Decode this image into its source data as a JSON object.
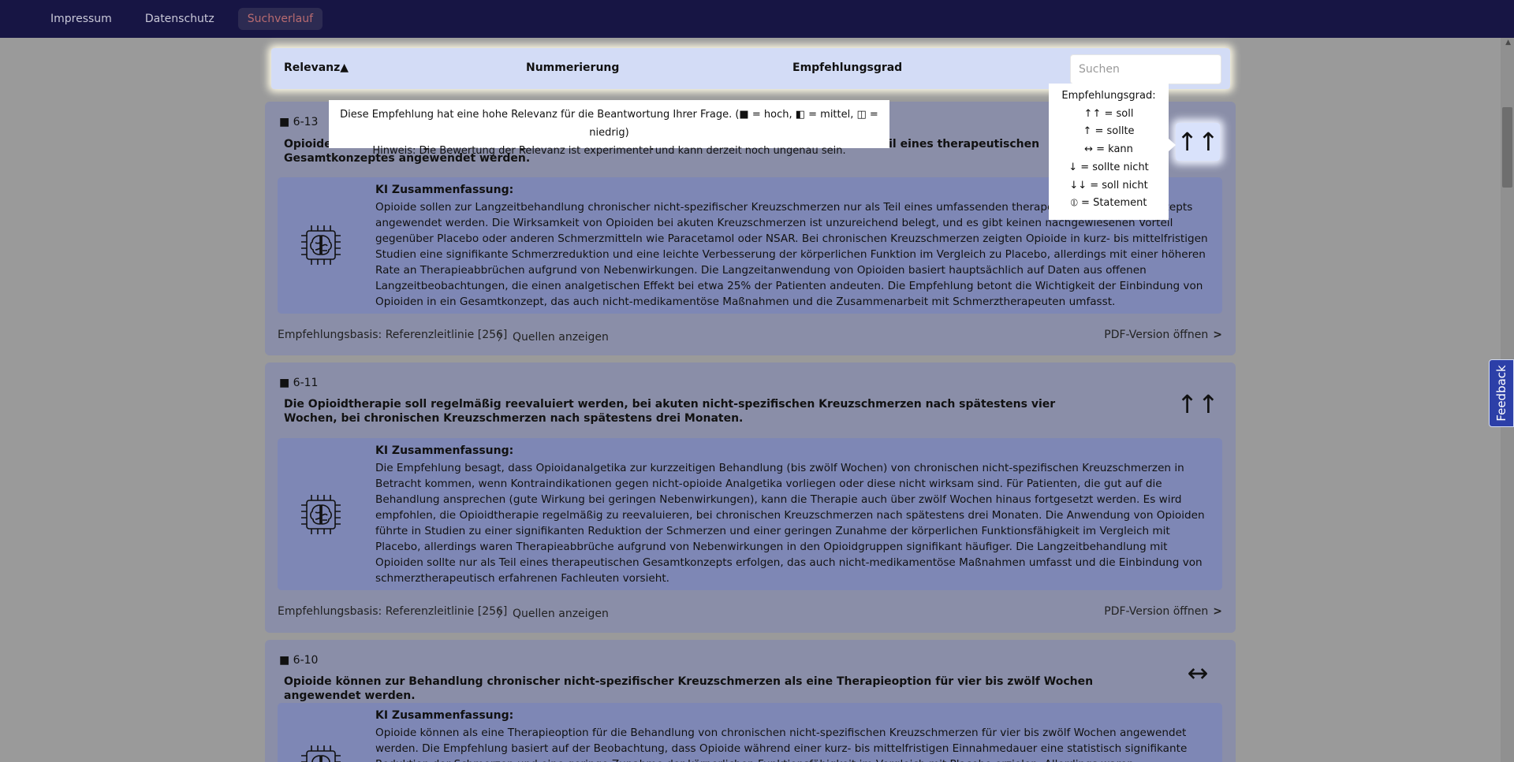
{
  "nav": {
    "items": [
      "Impressum",
      "Datenschutz",
      "Suchverlauf"
    ]
  },
  "sortbar": {
    "relevanz": "Relevanz▲",
    "nummerierung": "Nummerierung",
    "empfehlungsgrad": "Empfehlungsgrad",
    "search_placeholder": "Suchen"
  },
  "tooltip_relevance": {
    "line1": "Diese Empfehlung hat eine hohe Relevanz für die Beantwortung Ihrer Frage. (■ = hoch, ◧ = mittel, ◫ = niedrig)",
    "line2": "Hinweis: Die Bewertung der Relevanz ist experimentel und kann derzeit noch ungenau sein."
  },
  "tooltip_grade": {
    "title": "Empfehlungsgrad:",
    "items": [
      "↑↑ = soll",
      "↑ = sollte",
      "↔ = kann",
      "↓ = sollte nicht",
      "↓↓ = soll nicht",
      "⦶ = Statement"
    ]
  },
  "cards": [
    {
      "num": "■ 6-13",
      "title": "Opioide sollen zur Langzeitbehandlung chronischer nicht-spezifischer Kreuzschmerzen nur als Teil eines therapeutischen Gesamtkonzeptes angewendet werden.",
      "grade": "↑↑",
      "summary_head": "KI Zusammenfassung:",
      "summary": "Opioide sollen zur Langzeitbehandlung chronischer nicht-spezifischer Kreuzschmerzen nur als Teil eines umfassenden therapeutischen Gesamtkonzepts angewendet werden. Die Wirksamkeit von Opioiden bei akuten Kreuzschmerzen ist unzureichend belegt, und es gibt keinen nachgewiesenen Vorteil gegenüber Placebo oder anderen Schmerzmitteln wie Paracetamol oder NSAR. Bei chronischen Kreuzschmerzen zeigten Opioide in kurz- bis mittelfristigen Studien eine signifikante Schmerzreduktion und eine leichte Verbesserung der körperlichen Funktion im Vergleich zu Placebo, allerdings mit einer höheren Rate an Therapieabbrüchen aufgrund von Nebenwirkungen. Die Langzeitanwendung von Opioiden basiert hauptsächlich auf Daten aus offenen Langzeitbeobachtungen, die einen analgetischen Effekt bei etwa 25% der Patienten andeuten. Die Empfehlung betont die Wichtigkeit der Einbindung von Opioiden in ein Gesamtkonzept, das auch nicht-medikamentöse Maßnahmen und die Zusammenarbeit mit Schmerztherapeuten umfasst.",
      "basis": "Empfehlungsbasis: Referenzleitlinie [256]",
      "sources": "Quellen anzeigen",
      "pdf": "PDF-Version öffnen"
    },
    {
      "num": "■ 6-11",
      "title": "Die Opioidtherapie soll regelmäßig reevaluiert werden, bei akuten nicht-spezifischen Kreuzschmerzen nach spätestens vier Wochen, bei chronischen Kreuzschmerzen nach spätestens drei Monaten.",
      "grade": "↑↑",
      "summary_head": "KI Zusammenfassung:",
      "summary": "Die Empfehlung besagt, dass Opioidanalgetika zur kurzzeitigen Behandlung (bis zwölf Wochen) von chronischen nicht-spezifischen Kreuzschmerzen in Betracht kommen, wenn Kontraindikationen gegen nicht-opioide Analgetika vorliegen oder diese nicht wirksam sind. Für Patienten, die gut auf die Behandlung ansprechen (gute Wirkung bei geringen Nebenwirkungen), kann die Therapie auch über zwölf Wochen hinaus fortgesetzt werden. Es wird empfohlen, die Opioidtherapie regelmäßig zu reevaluieren, bei chronischen Kreuzschmerzen nach spätestens drei Monaten. Die Anwendung von Opioiden führte in Studien zu einer signifikanten Reduktion der Schmerzen und einer geringen Zunahme der körperlichen Funktionsfähigkeit im Vergleich mit Placebo, allerdings waren Therapieabbrüche aufgrund von Nebenwirkungen in den Opioidgruppen signifikant häufiger. Die Langzeitbehandlung mit Opioiden sollte nur als Teil eines therapeutischen Gesamtkonzepts erfolgen, das auch nicht-medikamentöse Maßnahmen umfasst und die Einbindung von schmerztherapeutisch erfahrenen Fachleuten vorsieht.",
      "basis": "Empfehlungsbasis: Referenzleitlinie [256]",
      "sources": "Quellen anzeigen",
      "pdf": "PDF-Version öffnen"
    },
    {
      "num": "■ 6-10",
      "title": "Opioide können zur Behandlung chronischer nicht-spezifischer Kreuzschmerzen als eine Therapieoption für vier bis zwölf Wochen angewendet werden.",
      "grade": "↔",
      "summary_head": "KI Zusammenfassung:",
      "summary": "Opioide können als eine Therapieoption für die Behandlung von chronischen nicht-spezifischen Kreuzschmerzen für vier bis zwölf Wochen angewendet werden. Die Empfehlung basiert auf der Beobachtung, dass Opioide während einer kurz- bis mittelfristigen Einnahmedauer eine statistisch signifikante Reduktion der Schmerzen und eine geringe Zunahme der körperlichen Funktionsfähigkeit im Vergleich mit Placebo erzielen. Allerdings waren"
    }
  ],
  "feedback": "Feedback"
}
